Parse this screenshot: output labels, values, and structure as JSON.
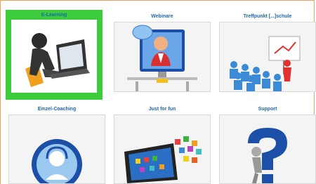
{
  "tiles": [
    {
      "label": "E-Learning",
      "icon": "person-laptop-icon"
    },
    {
      "label": "Webinare",
      "icon": "webinar-presenter-icon"
    },
    {
      "label": "Treffpunkt [...]schule",
      "icon": "classroom-presentation-icon"
    },
    {
      "label": "Einzel-Coaching",
      "icon": "headset-coach-icon"
    },
    {
      "label": "Just for fun",
      "icon": "tablet-apps-icon"
    },
    {
      "label": "Support",
      "icon": "question-mark-person-icon"
    }
  ],
  "colors": {
    "active_border": "#3ccc3c",
    "label": "#1a66b3",
    "frame": "#f0a060"
  }
}
